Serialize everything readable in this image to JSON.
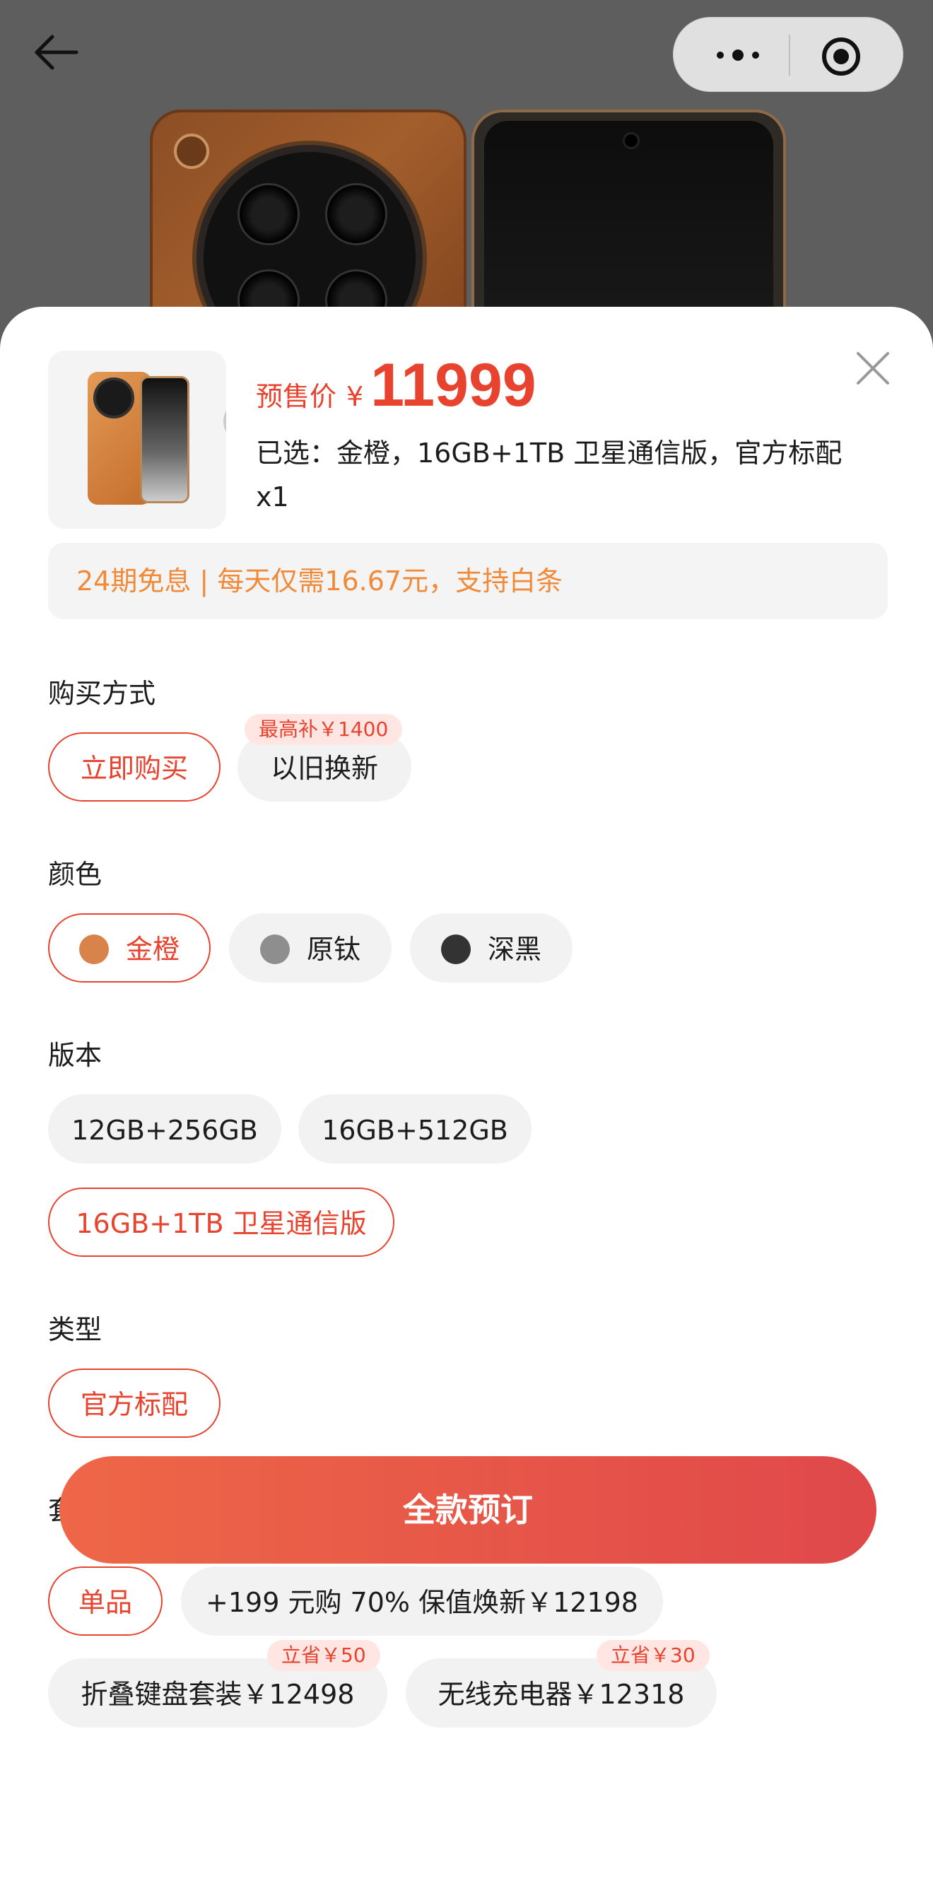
{
  "nav": {
    "back_icon": "arrow-left-icon",
    "more_icon": "more-dots-icon",
    "target_icon": "target-icon"
  },
  "product": {
    "price_label": "预售价",
    "currency": "¥",
    "price": "11999",
    "selected_text": "已选：金橙，16GB+1TB 卫星通信版，官方标配 x1",
    "installment": "24期免息 | 每天仅需16.67元，支持白条"
  },
  "sections": {
    "purchase": {
      "title": "购买方式",
      "options": [
        "立即购买",
        "以旧换新"
      ],
      "tag": "最高补￥1400",
      "selected": "立即购买"
    },
    "color": {
      "title": "颜色",
      "options": [
        {
          "label": "金橙",
          "swatch": "#d8834a"
        },
        {
          "label": "原钛",
          "swatch": "#8e8e8e"
        },
        {
          "label": "深黑",
          "swatch": "#333333"
        }
      ],
      "selected": "金橙"
    },
    "version": {
      "title": "版本",
      "options": [
        "12GB+256GB",
        "16GB+512GB",
        "16GB+1TB 卫星通信版"
      ],
      "selected": "16GB+1TB 卫星通信版"
    },
    "type": {
      "title": "类型",
      "options": [
        "官方标配"
      ],
      "selected": "官方标配"
    },
    "bundle": {
      "title": "套餐",
      "options": [
        "单品",
        "+199 元购 70% 保值焕新￥12198",
        "折叠键盘套装￥12498",
        "无线充电器￥12318"
      ],
      "tags": [
        "立省￥50",
        "立省￥30"
      ],
      "selected": "单品"
    }
  },
  "cta": {
    "label": "全款预订"
  },
  "colors": {
    "accent": "#e8432f",
    "installment_text": "#f08a38"
  }
}
